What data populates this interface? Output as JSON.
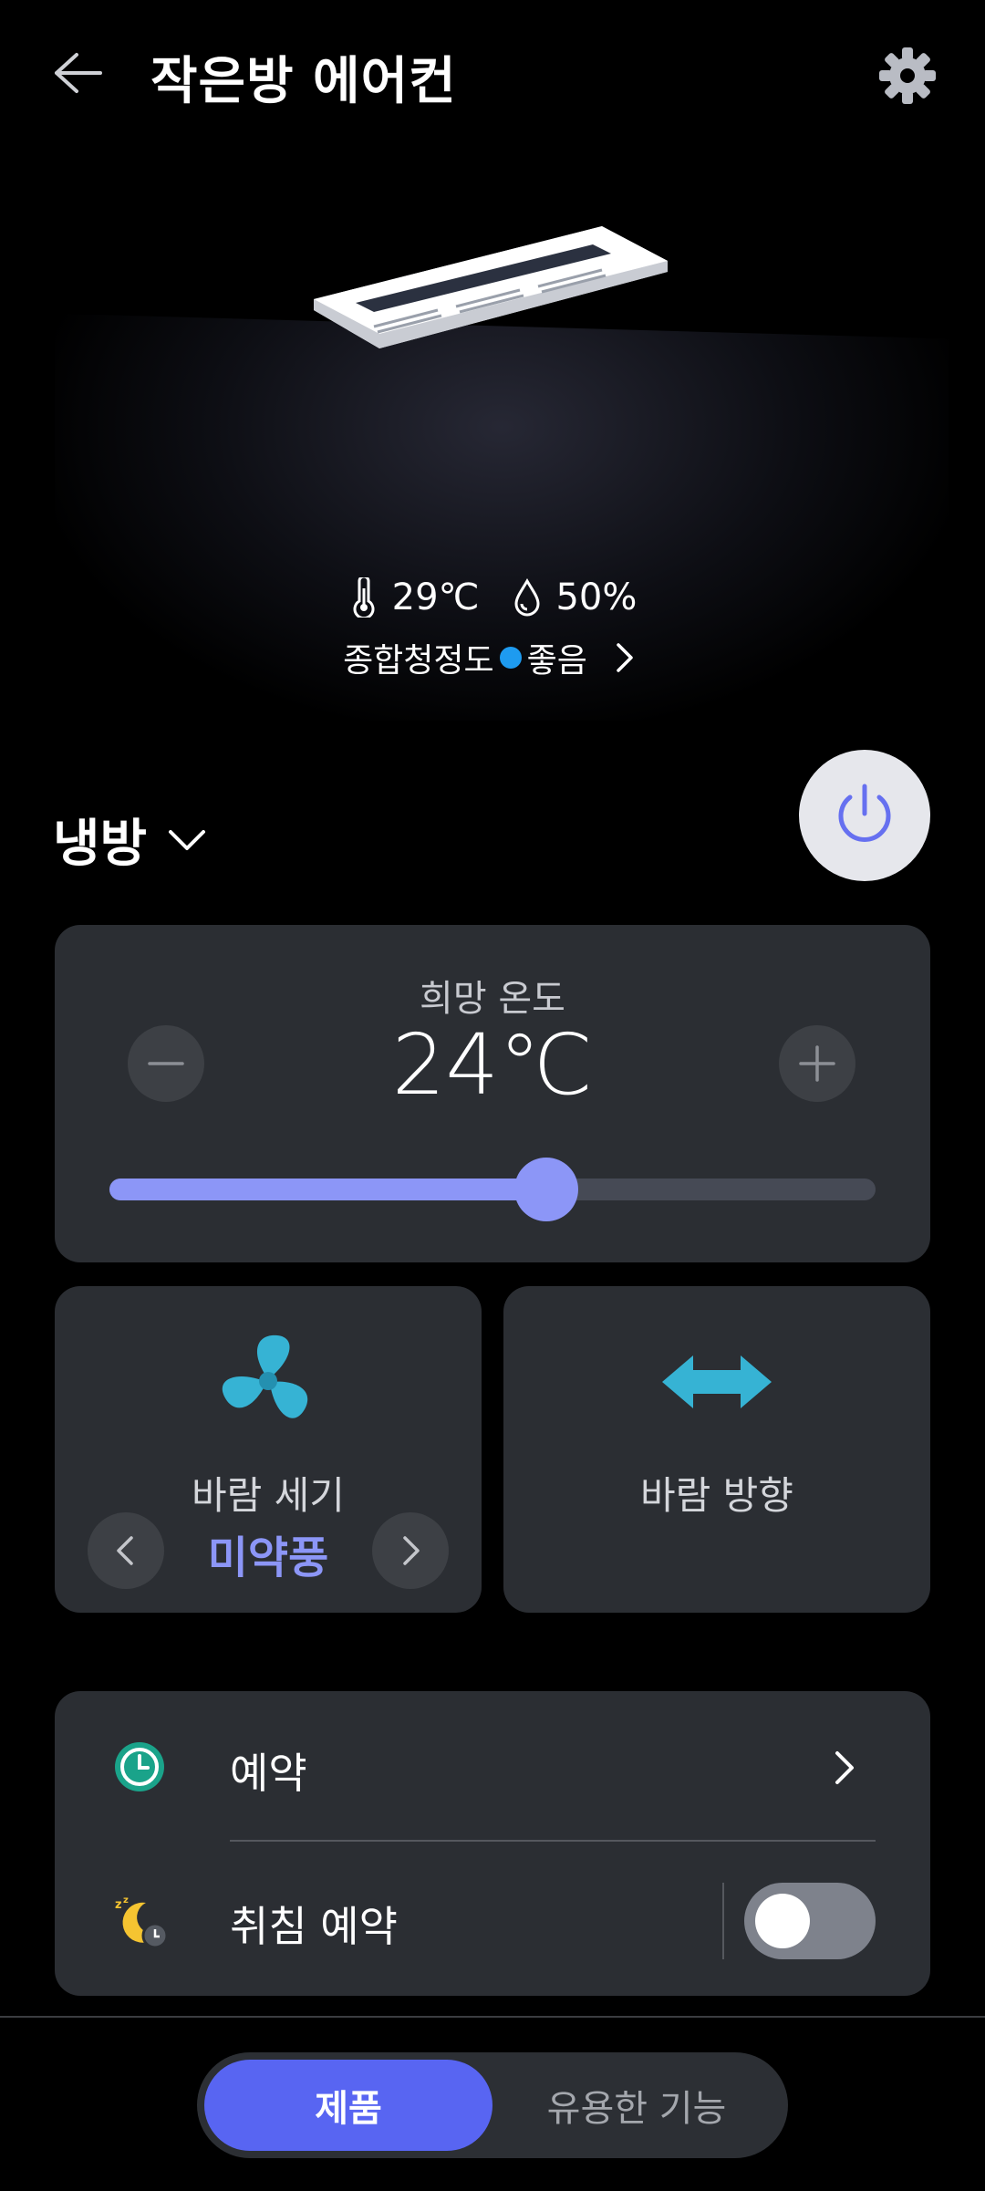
{
  "header": {
    "title": "작은방 에어컨",
    "back_icon": "arrow-left-icon",
    "settings_icon": "gear-icon"
  },
  "status": {
    "temperature": "29℃",
    "humidity": "50%",
    "air_quality_label": "종합청정도",
    "air_quality_value": "좋음",
    "air_quality_color": "#1e9bf0"
  },
  "mode": {
    "label": "냉방"
  },
  "power": {
    "color": "#6670f0"
  },
  "target_temp": {
    "label": "희망 온도",
    "value": "24℃",
    "slider_fraction": 0.57
  },
  "wind_strength": {
    "label": "바람 세기",
    "value": "미약풍"
  },
  "wind_direction": {
    "label": "바람 방향"
  },
  "schedule": {
    "label": "예약"
  },
  "sleep_schedule": {
    "label": "취침 예약",
    "enabled": false
  },
  "tabs": [
    {
      "label": "제품",
      "active": true
    },
    {
      "label": "유용한 기능",
      "active": false
    }
  ],
  "colors": {
    "accent": "#5865f2",
    "slider": "#8c96f7",
    "card": "#2b2e33",
    "fan": "#36b3d4"
  }
}
